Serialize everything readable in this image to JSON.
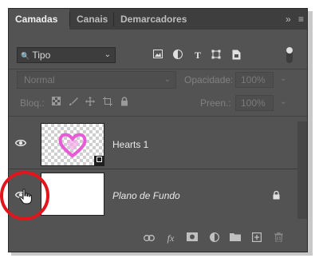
{
  "tabs": [
    {
      "label": "Camadas",
      "active": true
    },
    {
      "label": "Canais",
      "active": false
    },
    {
      "label": "Demarcadores",
      "active": false
    }
  ],
  "tabbar_right": {
    "collapse": "»",
    "menu": "≡"
  },
  "filter": {
    "search_glyph": "🔍",
    "kind": "Tipo",
    "chevron": "⌄"
  },
  "filter_icons": [
    "image-icon",
    "adjustment-icon",
    "type-icon",
    "shape-icon",
    "smart-object-icon"
  ],
  "blend_mode": {
    "value": "Normal",
    "chevron": "⌄"
  },
  "opacity": {
    "label": "Opacidade:",
    "value": "100%",
    "chevron": "⌄"
  },
  "lock": {
    "label": "Bloq.:"
  },
  "fill": {
    "label": "Preen.:",
    "value": "100%",
    "chevron": "⌄"
  },
  "layers": [
    {
      "name": "Hearts 1",
      "visible": true,
      "type": "smart-object"
    },
    {
      "name": "Plano de Fundo",
      "visible": true,
      "locked": true
    }
  ],
  "bottom_icons": [
    "link-icon",
    "fx-icon",
    "mask-icon",
    "adjustment-layer-icon",
    "folder-icon",
    "new-layer-icon",
    "trash-icon"
  ],
  "bottom_labels": {
    "fx": "fx"
  },
  "colors": {
    "panel": "#535353",
    "tabbar": "#3e3e3e",
    "highlight_circle": "#e3141c",
    "heart": "#e85bd6"
  }
}
